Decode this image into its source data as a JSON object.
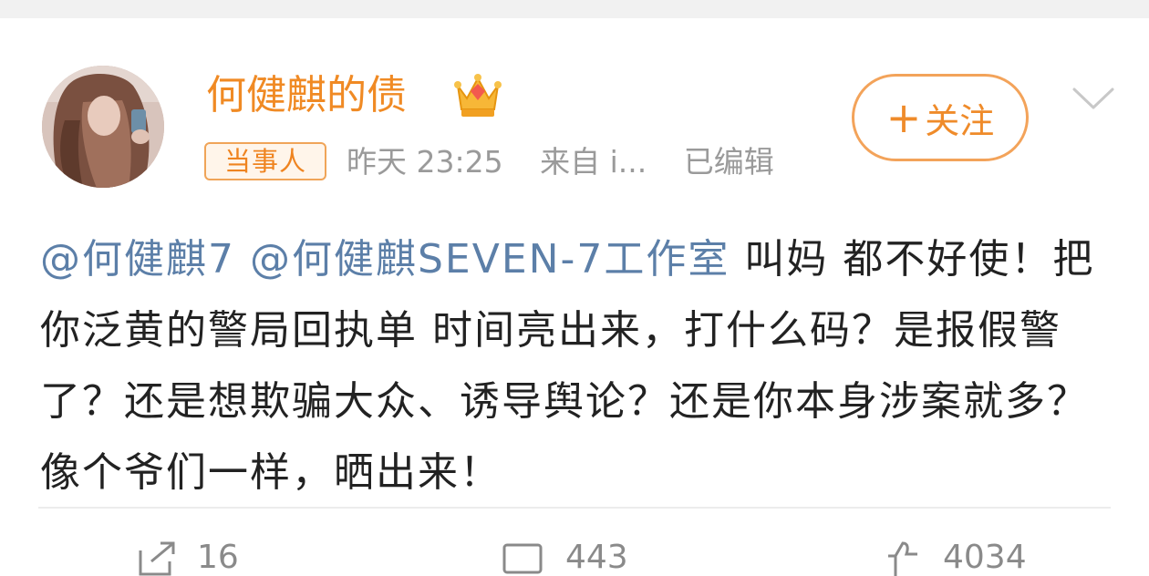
{
  "post": {
    "username": "何健麒的债",
    "badge": "当事人",
    "time": "昨天 23:25",
    "source": "来自 i...",
    "edited": "已编辑",
    "follow_label": "关注",
    "mention1": "@何健麒7",
    "mention2": "@何健麒SEVEN-7工作室",
    "text": "  叫妈 都不好使！把你泛黄的警局回执单 时间亮出来，打什么码？是报假警了？还是想欺骗大众、诱导舆论？还是你本身涉案就多？像个爷们一样，晒出来！"
  },
  "actions": {
    "repost_count": "16",
    "comment_count": "443",
    "like_count": "4034"
  },
  "colors": {
    "username": "#f08a24",
    "mention": "#5c7fa8",
    "meta": "#9a9a9a",
    "follow_border": "#f3a35a"
  },
  "icons": [
    "crown-icon",
    "chevron-down-icon",
    "repost-icon",
    "comment-icon",
    "like-icon"
  ]
}
